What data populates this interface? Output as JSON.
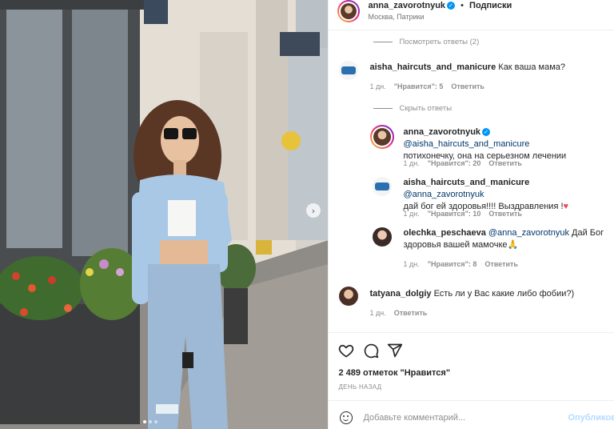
{
  "header": {
    "username": "anna_zavorotnyuk",
    "separator": "•",
    "follow_label": "Подписки",
    "location": "Москва, Патрики"
  },
  "comments": [
    {
      "view_replies": "Посмотреть ответы (2)"
    },
    {
      "username": "aisha_haircuts_and_manicure",
      "text": "Как ваша мама?",
      "time": "1 дн.",
      "likes": "\"Нравится\": 5",
      "reply": "Ответить"
    },
    {
      "hide_replies": "Скрыть ответы"
    }
  ],
  "replies": [
    {
      "username": "anna_zavorotnyuk",
      "mention": "@aisha_haircuts_and_manicure",
      "text": "потихонечку, она на серьезном лечении",
      "time": "1 дн.",
      "likes": "\"Нравится\": 20",
      "reply": "Ответить"
    },
    {
      "username": "aisha_haircuts_and_manicure",
      "mention": "@anna_zavorotnyuk",
      "text": "дай бог ей здоровья!!!! Выздравления !",
      "heart": "♥",
      "time": "1 дн.",
      "likes": "\"Нравится\": 10",
      "reply": "Ответить"
    },
    {
      "username": "olechka_peschaeva",
      "mention": "@anna_zavorotnyuk",
      "text1": "Дай Бог",
      "text2": "здоровья вашей мамочке",
      "emoji": "🙏",
      "time": "1 дн.",
      "likes": "\"Нравится\": 8",
      "reply": "Ответить"
    }
  ],
  "last_comment": {
    "username": "tatyana_dolgiy",
    "text": "Есть ли у Вас какие либо фобии?)",
    "time": "1 дн.",
    "reply": "Ответить"
  },
  "footer": {
    "likes": "2 489 отметок \"Нравится\"",
    "ago": "ДЕНЬ НАЗАД",
    "comment_placeholder": "Добавьте комментарий...",
    "publish": "Опубликов"
  },
  "photo": {
    "slides": 3,
    "active_slide": 1
  },
  "colors": {
    "link": "#00376b",
    "publish": "#b3dbff",
    "verified": "#0095f6"
  }
}
